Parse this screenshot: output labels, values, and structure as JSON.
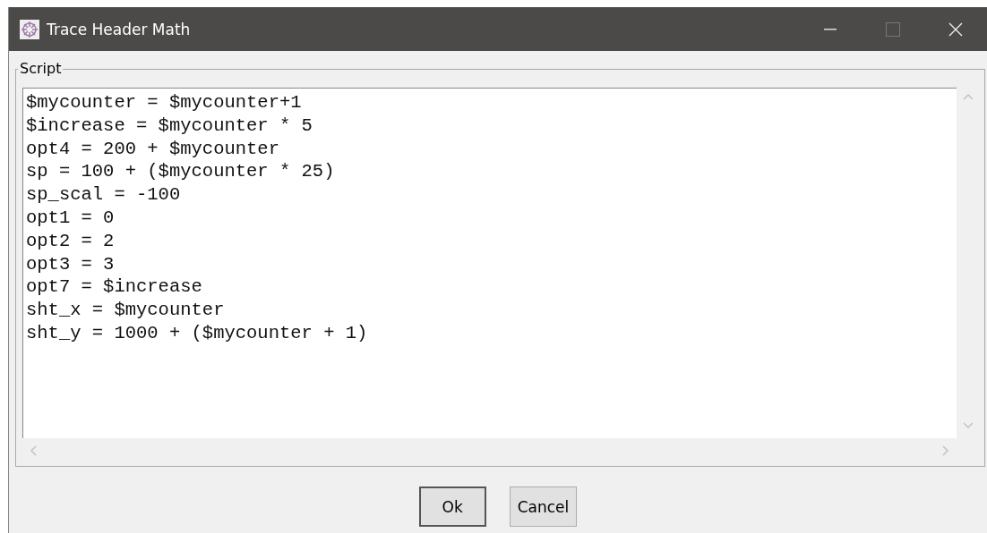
{
  "window": {
    "title": "Trace Header Math"
  },
  "script_group": {
    "label": "Script",
    "lines": [
      "$mycounter = $mycounter+1",
      "$increase = $mycounter * 5",
      "opt4 = 200 + $mycounter",
      "sp = 100 + ($mycounter * 25)",
      "sp_scal = -100",
      "opt1 = 0",
      "opt2 = 2",
      "opt3 = 3",
      "opt7 = $increase",
      "sht_x = $mycounter",
      "sht_y = 1000 + ($mycounter + 1)"
    ]
  },
  "buttons": [
    {
      "label": "Ok",
      "default": true
    },
    {
      "label": "Cancel",
      "default": false
    }
  ]
}
